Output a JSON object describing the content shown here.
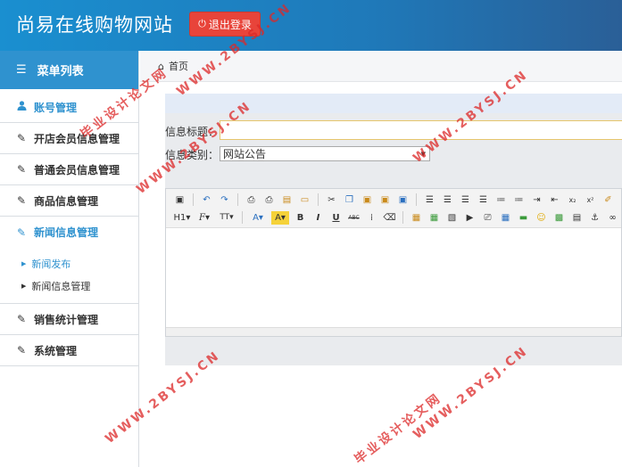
{
  "header": {
    "title": "尚易在线购物网站",
    "logout_label": "退出登录",
    "colors": {
      "bar": "#1f79b9",
      "logout": "#e8443a"
    }
  },
  "sidebar": {
    "heading": "菜单列表",
    "groups": [
      {
        "label": "账号管理",
        "icon": "user-icon"
      },
      {
        "label": "开店会员信息管理",
        "icon": "edit-icon"
      },
      {
        "label": "普通会员信息管理",
        "icon": "edit-icon"
      },
      {
        "label": "商品信息管理",
        "icon": "edit-icon"
      },
      {
        "label": "新闻信息管理",
        "icon": "edit-icon"
      },
      {
        "label": "销售统计管理",
        "icon": "edit-icon"
      },
      {
        "label": "系统管理",
        "icon": "edit-icon"
      }
    ],
    "sub_items": [
      {
        "label": "新闻发布",
        "current": true
      },
      {
        "label": "新闻信息管理",
        "current": false
      }
    ]
  },
  "breadcrumb": {
    "home_label": "首页"
  },
  "form": {
    "title_label": "信息标题：",
    "title_value": "",
    "type_label": "信息类别：",
    "type_value": "网站公告"
  },
  "editor": {
    "toolbar_row1": [
      "source-icon",
      "undo-icon",
      "redo-icon",
      "preview-icon",
      "print-icon",
      "template-icon",
      "code-icon",
      "cut-icon",
      "copy-icon",
      "paste-icon",
      "paste-text-icon",
      "paste-word-icon",
      "align-left-icon",
      "align-center-icon",
      "align-right-icon",
      "justify-icon",
      "ordered-list-icon",
      "unordered-list-icon",
      "indent-icon",
      "outdent-icon",
      "subscript-icon",
      "superscript-icon",
      "clear-format-icon",
      "select-all-icon"
    ],
    "toolbar_row2_labels": {
      "heading": "H1",
      "font": "F",
      "size": "TT",
      "forecolor": "A",
      "hilitecolor": "A",
      "bold": "B",
      "italic": "I",
      "underline": "U",
      "strike": "ABC"
    }
  },
  "watermarks": [
    "毕业设计论文网",
    "WWW.2BYSJ.CN",
    "WWW.2BYSJ.CN",
    "WWW.2BYSJ.CN",
    "毕业设计论文网",
    "WWW.2BYSJ.CN",
    "WWW.2BYSJ.CN"
  ]
}
